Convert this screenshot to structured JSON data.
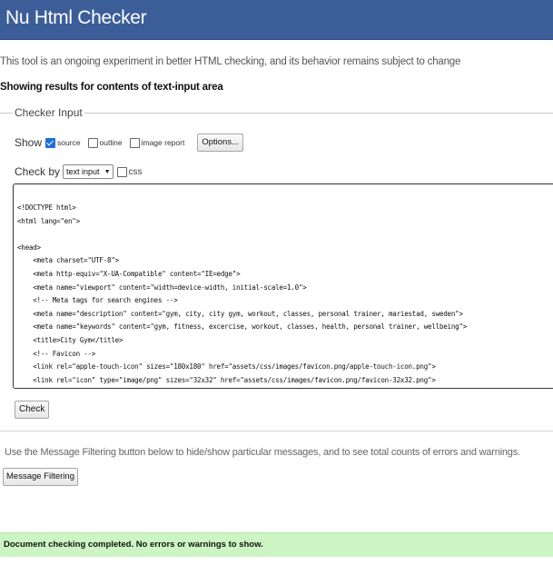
{
  "header": {
    "title": "Nu Html Checker"
  },
  "intro_text": "This tool is an ongoing experiment in better HTML checking, and its behavior remains subject to change",
  "results_heading": "Showing results for contents of text-input area",
  "checker_input": {
    "legend": "Checker Input",
    "show": {
      "label": "Show",
      "options": [
        {
          "label": "source",
          "checked": true
        },
        {
          "label": "outline",
          "checked": false
        },
        {
          "label": "image report",
          "checked": false
        }
      ],
      "options_button": "Options..."
    },
    "check_by": {
      "label": "Check by",
      "selected": "text input",
      "css_label": "css",
      "css_checked": false
    },
    "code": "<!DOCTYPE html>\n<html lang=\"en\">\n\n<head>\n    <meta charset=\"UTF-8\">\n    <meta http-equiv=\"X-UA-Compatible\" content=\"IE=edge\">\n    <meta name=\"viewport\" content=\"width=device-width, initial-scale=1.0\">\n    <!-- Meta tags for search engines -->\n    <meta name=\"description\" content=\"gym, city, city gym, workout, classes, personal trainer, mariestad, sweden\">\n    <meta name=\"keywords\" content=\"gym, fitness, excercise, workout, classes, health, personal trainer, wellbeing\">\n    <title>City Gym</title>\n    <!-- Favicon -->\n    <link rel=\"apple-touch-icon\" sizes=\"180x180\" href=\"assets/css/images/favicon.png/apple-touch-icon.png\">\n    <link rel=\"icon\" type=\"image/png\" sizes=\"32x32\" href=\"assets/css/images/favicon.png/favicon-32x32.png\">",
    "check_button": "Check"
  },
  "filter": {
    "note": "Use the Message Filtering button below to hide/show particular messages, and to see total counts of errors and warnings.",
    "button": "Message Filtering"
  },
  "status": {
    "message": "Document checking completed. No errors or warnings to show."
  },
  "colors": {
    "header_bg": "#3b5e98",
    "success_bg": "#ccf5c3",
    "checkbox_accent": "#1f6fd6"
  }
}
